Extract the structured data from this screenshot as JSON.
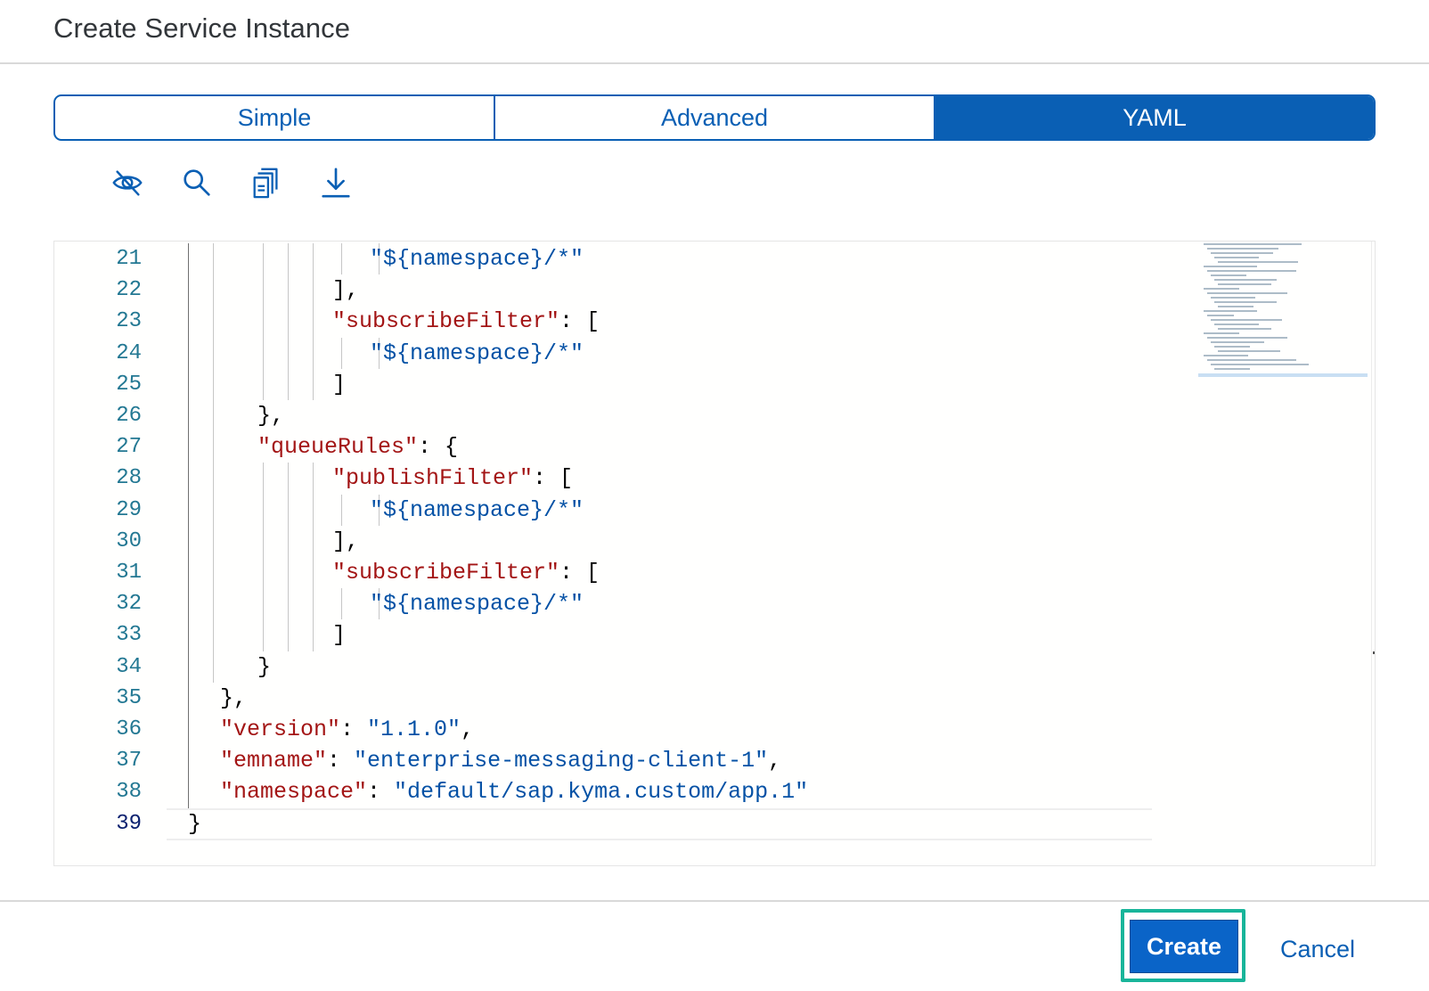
{
  "dialog": {
    "title": "Create Service Instance"
  },
  "tabs": [
    {
      "label": "Simple",
      "active": false
    },
    {
      "label": "Advanced",
      "active": false
    },
    {
      "label": "YAML",
      "active": true
    }
  ],
  "toolbar": {
    "icons": [
      "hide-eye-icon",
      "search-icon",
      "copy-icon",
      "download-icon"
    ]
  },
  "editor": {
    "current_line": "39",
    "lines": [
      {
        "n": "21",
        "text": "\"${namespace}/*\""
      },
      {
        "n": "22",
        "text": "],"
      },
      {
        "n": "23",
        "text": "\"subscribeFilter\": ["
      },
      {
        "n": "24",
        "text": "\"${namespace}/*\""
      },
      {
        "n": "25",
        "text": "]"
      },
      {
        "n": "26",
        "text": "},"
      },
      {
        "n": "27",
        "text": "\"queueRules\": {"
      },
      {
        "n": "28",
        "text": "\"publishFilter\": ["
      },
      {
        "n": "29",
        "text": "\"${namespace}/*\""
      },
      {
        "n": "30",
        "text": "],"
      },
      {
        "n": "31",
        "text": "\"subscribeFilter\": ["
      },
      {
        "n": "32",
        "text": "\"${namespace}/*\""
      },
      {
        "n": "33",
        "text": "]"
      },
      {
        "n": "34",
        "text": "}"
      },
      {
        "n": "35",
        "text": "},"
      },
      {
        "n": "36",
        "text": "\"version\": \"1.1.0\","
      },
      {
        "n": "37",
        "text": "\"emname\": \"enterprise-messaging-client-1\","
      },
      {
        "n": "38",
        "text": "\"namespace\": \"default/sap.kyma.custom/app.1\""
      },
      {
        "n": "39",
        "text": "}"
      }
    ]
  },
  "footer": {
    "create_label": "Create",
    "cancel_label": "Cancel"
  },
  "colors": {
    "accent": "#0a5fb4",
    "create_highlight": "#18b59a",
    "key_color": "#0451a5",
    "gutter_color": "#237893"
  }
}
